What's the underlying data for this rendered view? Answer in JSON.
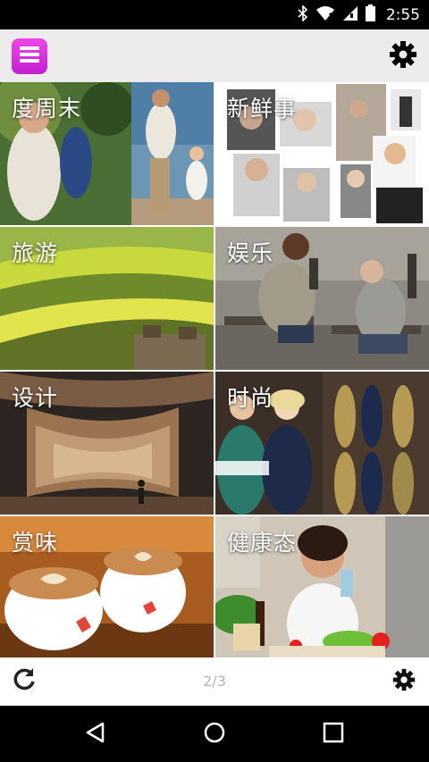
{
  "status_bar": {
    "time": "2:55",
    "icons": [
      "bluetooth-icon",
      "wifi-icon",
      "cell-signal-icon",
      "battery-icon"
    ]
  },
  "app_bar": {
    "menu_icon": "menu-icon",
    "settings_icon": "gear-icon",
    "accent_color": "#d92fd9"
  },
  "tiles": [
    {
      "label": "度周末",
      "image": "family walking on beach"
    },
    {
      "label": "新鲜事",
      "image": "portrait collage"
    },
    {
      "label": "旅游",
      "image": "terraced rapeseed fields"
    },
    {
      "label": "娱乐",
      "image": "two men sitting on benches"
    },
    {
      "label": "设计",
      "image": "wooden curved interior"
    },
    {
      "label": "时尚",
      "image": "fashion models"
    },
    {
      "label": "赏味",
      "image": "latte art coffee cups"
    },
    {
      "label": "健康态",
      "image": "woman in kitchen with vegetables"
    }
  ],
  "bottom_bar": {
    "refresh_icon": "refresh-icon",
    "page_indicator": "2/3",
    "settings_icon": "gear-icon"
  },
  "nav_bar": {
    "icons": [
      "back-icon",
      "home-icon",
      "recents-icon"
    ]
  }
}
